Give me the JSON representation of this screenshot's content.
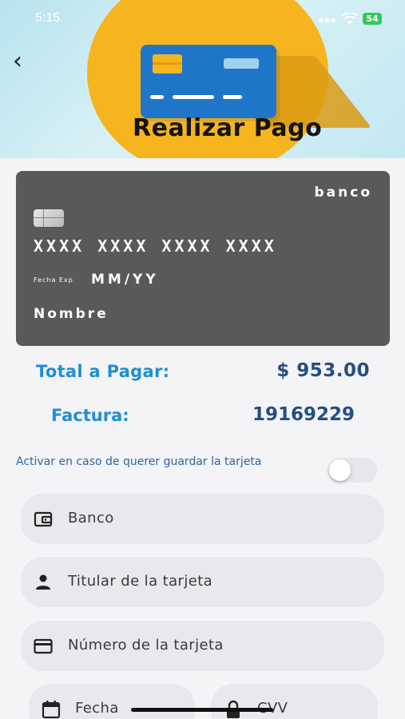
{
  "status_bar": {
    "time": "5:15",
    "battery": "54"
  },
  "header": {
    "title": "Realizar Pago"
  },
  "card_preview": {
    "bank": "banco",
    "number": "XXXX XXXX XXXX XXXX",
    "exp_label": "Fecha Exp",
    "exp_value": "MM/YY",
    "name": "Nombre"
  },
  "summary": {
    "total_label": "Total a Pagar:",
    "total_value": "$ 953.00",
    "invoice_label": "Factura:",
    "invoice_value": "19169229"
  },
  "save_card": {
    "text": "Activar en caso de querer guardar la tarjeta",
    "enabled": false
  },
  "form": {
    "bank_placeholder": "Banco",
    "holder_placeholder": "Titular de la tarjeta",
    "number_placeholder": "Número de la tarjeta",
    "date_placeholder": "Fecha",
    "cvv_placeholder": "CVV"
  },
  "colors": {
    "accent": "#1f8ed6",
    "value": "#244e84",
    "brand": "#f6b51e",
    "card": "#5b5858"
  },
  "icons": [
    "back-arrow-icon",
    "credit-card-illustration",
    "wallet-icon",
    "person-icon",
    "credit-card-icon",
    "calendar-icon",
    "lock-icon"
  ]
}
